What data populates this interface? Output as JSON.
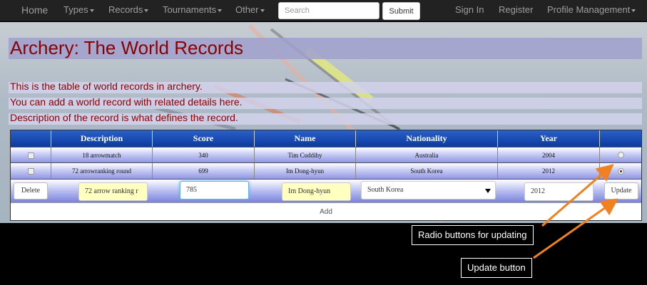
{
  "navbar": {
    "home": "Home",
    "types": "Types",
    "records": "Records",
    "tournaments": "Tournaments",
    "other": "Other",
    "search_placeholder": "Search",
    "submit": "Submit",
    "sign_in": "Sign In",
    "register": "Register",
    "profile": "Profile Management"
  },
  "page": {
    "title": "Archery: The World Records",
    "descriptions": [
      "This is the table of world records in archery.",
      "You can add a world record with related details here.",
      "Description of the record is what defines the record."
    ]
  },
  "table": {
    "headers": [
      "Description",
      "Score",
      "Name",
      "Nationality",
      "Year"
    ],
    "rows": [
      {
        "description": "18 arrowmatch",
        "score": "340",
        "name": "Tim Cuddihy",
        "nationality": "Australia",
        "year": "2004",
        "selected": false
      },
      {
        "description": "72 arrowranking round",
        "score": "699",
        "name": "Im Dong-hyun",
        "nationality": "South Korea",
        "year": "2012",
        "selected": true
      }
    ],
    "edit": {
      "delete": "Delete",
      "description": "72 arrow ranking r",
      "score": "785",
      "name": "Im Dong-hyun",
      "nationality": "South Korea",
      "year": "2012",
      "update": "Update"
    },
    "add": "Add"
  },
  "annotations": {
    "radio_label": "Radio buttons for updating",
    "update_label": "Update button"
  },
  "colors": {
    "accent_text": "#8b0000",
    "header_blue": "#0b3aa0",
    "arrow_orange": "#f08020"
  }
}
